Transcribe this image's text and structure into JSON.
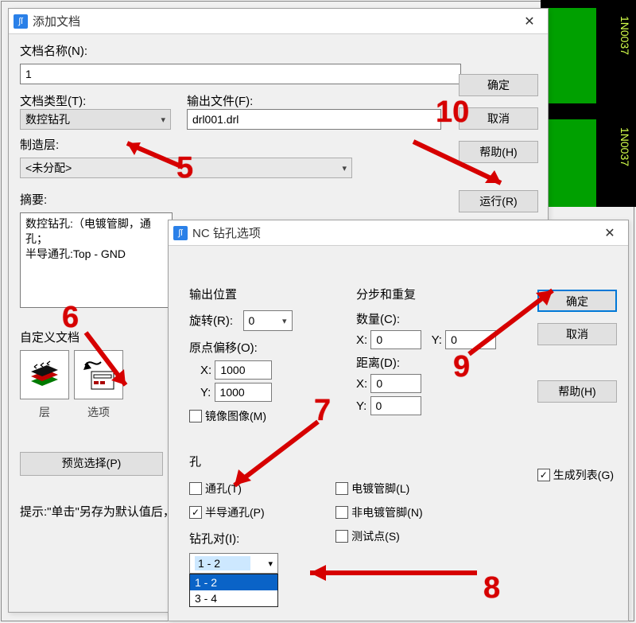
{
  "bg": {
    "label_a": "1N0037",
    "label_b": "1N0037"
  },
  "win1": {
    "title": "添加文档",
    "close": "✕",
    "doc_name_label": "文档名称(N):",
    "doc_name_value": "1",
    "doc_type_label": "文档类型(T):",
    "doc_type_value": "数控钻孔",
    "output_file_label": "输出文件(F):",
    "output_file_value": "drl001.drl",
    "mfg_layer_label": "制造层:",
    "mfg_layer_value": "<未分配>",
    "summary_label": "摘要:",
    "summary_text": "数控钻孔:（电镀管脚，通孔；\n半导通孔:Top - GND",
    "custom_doc_label": "自定义文档",
    "layer_label": "层",
    "options_label": "选项",
    "preview_button": "预览选择(P)",
    "hint": "提示:\"单击\"另存为默认值后，文档类型和输出设备的默认...",
    "buttons": {
      "ok": "确定",
      "cancel": "取消",
      "help": "帮助(H)",
      "run": "运行(R)"
    }
  },
  "win2": {
    "title": "NC 钻孔选项",
    "close": "✕",
    "output_pos_label": "输出位置",
    "rotate_label": "旋转(R):",
    "rotate_value": "0",
    "origin_offset_label": "原点偏移(O):",
    "origin_x_label": "X:",
    "origin_x_value": "1000",
    "origin_y_label": "Y:",
    "origin_y_value": "1000",
    "mirror_label": "镜像图像(M)",
    "step_repeat_label": "分步和重复",
    "count_label": "数量(C):",
    "count_x_label": "X:",
    "count_x_value": "0",
    "count_y_label": "Y:",
    "count_y_value": "0",
    "distance_label": "距离(D):",
    "distance_x_label": "X:",
    "distance_x_value": "0",
    "distance_y_label": "Y:",
    "distance_y_value": "0",
    "hole_label": "孔",
    "through_hole_label": "通孔(T)",
    "partial_via_label": "半导通孔(P)",
    "plated_pin_label": "电镀管脚(L)",
    "nonplated_pin_label": "非电镀管脚(N)",
    "testpoint_label": "测试点(S)",
    "drill_pair_label": "钻孔对(I):",
    "drill_pair_value": "1 - 2",
    "drill_pair_options": [
      "1 - 2",
      "3 - 4"
    ],
    "generate_list_label": "生成列表(G)",
    "buttons": {
      "ok": "确定",
      "cancel": "取消",
      "help": "帮助(H)"
    }
  },
  "annotations": {
    "n5": "5",
    "n6": "6",
    "n7": "7",
    "n8": "8",
    "n9": "9",
    "n10": "10"
  }
}
